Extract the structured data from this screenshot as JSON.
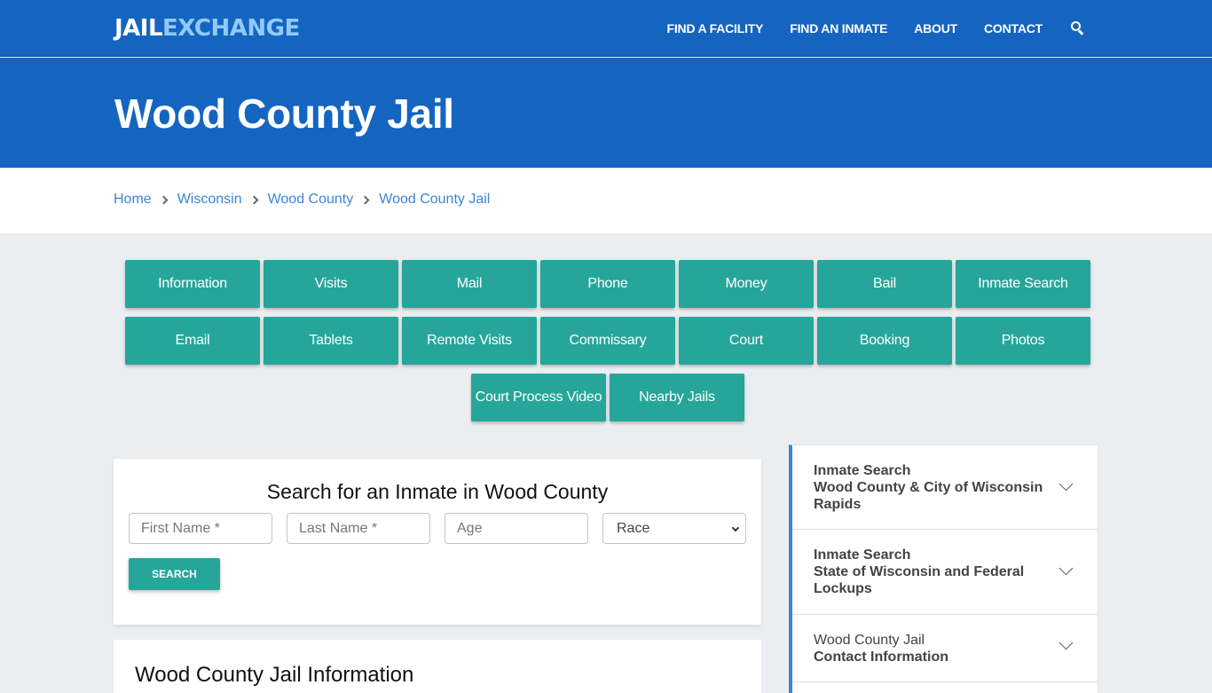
{
  "header": {
    "logo_part1": "JAIL",
    "logo_part2": "EXCHANGE",
    "nav": [
      "FIND A FACILITY",
      "FIND AN INMATE",
      "ABOUT",
      "CONTACT"
    ],
    "search_icon": "search-icon"
  },
  "hero": {
    "title": "Wood County Jail"
  },
  "breadcrumb": [
    "Home",
    "Wisconsin",
    "Wood County",
    "Wood County Jail"
  ],
  "topic_buttons": {
    "row1": [
      "Information",
      "Visits",
      "Mail",
      "Phone",
      "Money",
      "Bail",
      "Inmate Search"
    ],
    "row2": [
      "Email",
      "Tablets",
      "Remote Visits",
      "Commissary",
      "Court",
      "Booking",
      "Photos"
    ],
    "row3": [
      "Court Process Video",
      "Nearby Jails"
    ]
  },
  "search_form": {
    "title": "Search for an Inmate in Wood County",
    "first_name_placeholder": "First Name *",
    "last_name_placeholder": "Last Name *",
    "age_placeholder": "Age",
    "race_selected": "Race",
    "submit_label": "SEARCH"
  },
  "info_section": {
    "title": "Wood County Jail Information"
  },
  "sidebar": {
    "items": [
      {
        "line1": "Inmate Search",
        "line2": "Wood County & City of Wisconsin",
        "line3": "Rapids"
      },
      {
        "line1": "Inmate Search",
        "line2": "State of Wisconsin and Federal",
        "line3": "Lockups"
      },
      {
        "line1": "Wood County Jail",
        "line2": "Contact Information"
      }
    ]
  },
  "colors": {
    "brand_blue": "#1565c0",
    "logo_accent": "#90caf9",
    "teal_button": "#26a69a",
    "link_blue": "#3b86d6"
  }
}
